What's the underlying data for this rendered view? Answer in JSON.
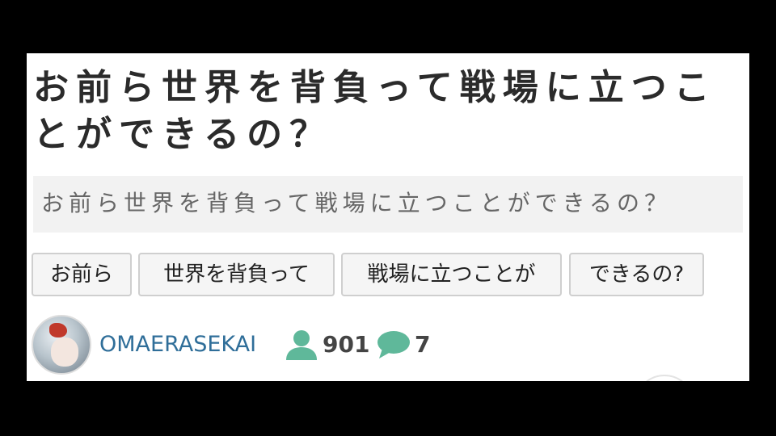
{
  "article": {
    "title": "お前ら世界を背負って戦場に立つことができるの？",
    "subtitle": "お前ら世界を背負って戦場に立つことができるの？"
  },
  "tags": [
    "お前ら",
    "世界を背負って",
    "戦場に立つことが",
    "できるの?"
  ],
  "author": {
    "name": "OMAERASEKAI",
    "followers": "901",
    "comments": "7"
  },
  "icons": {
    "followers": "user-icon",
    "comments": "speech-bubble-icon",
    "accent_color": "#5fb89a"
  }
}
